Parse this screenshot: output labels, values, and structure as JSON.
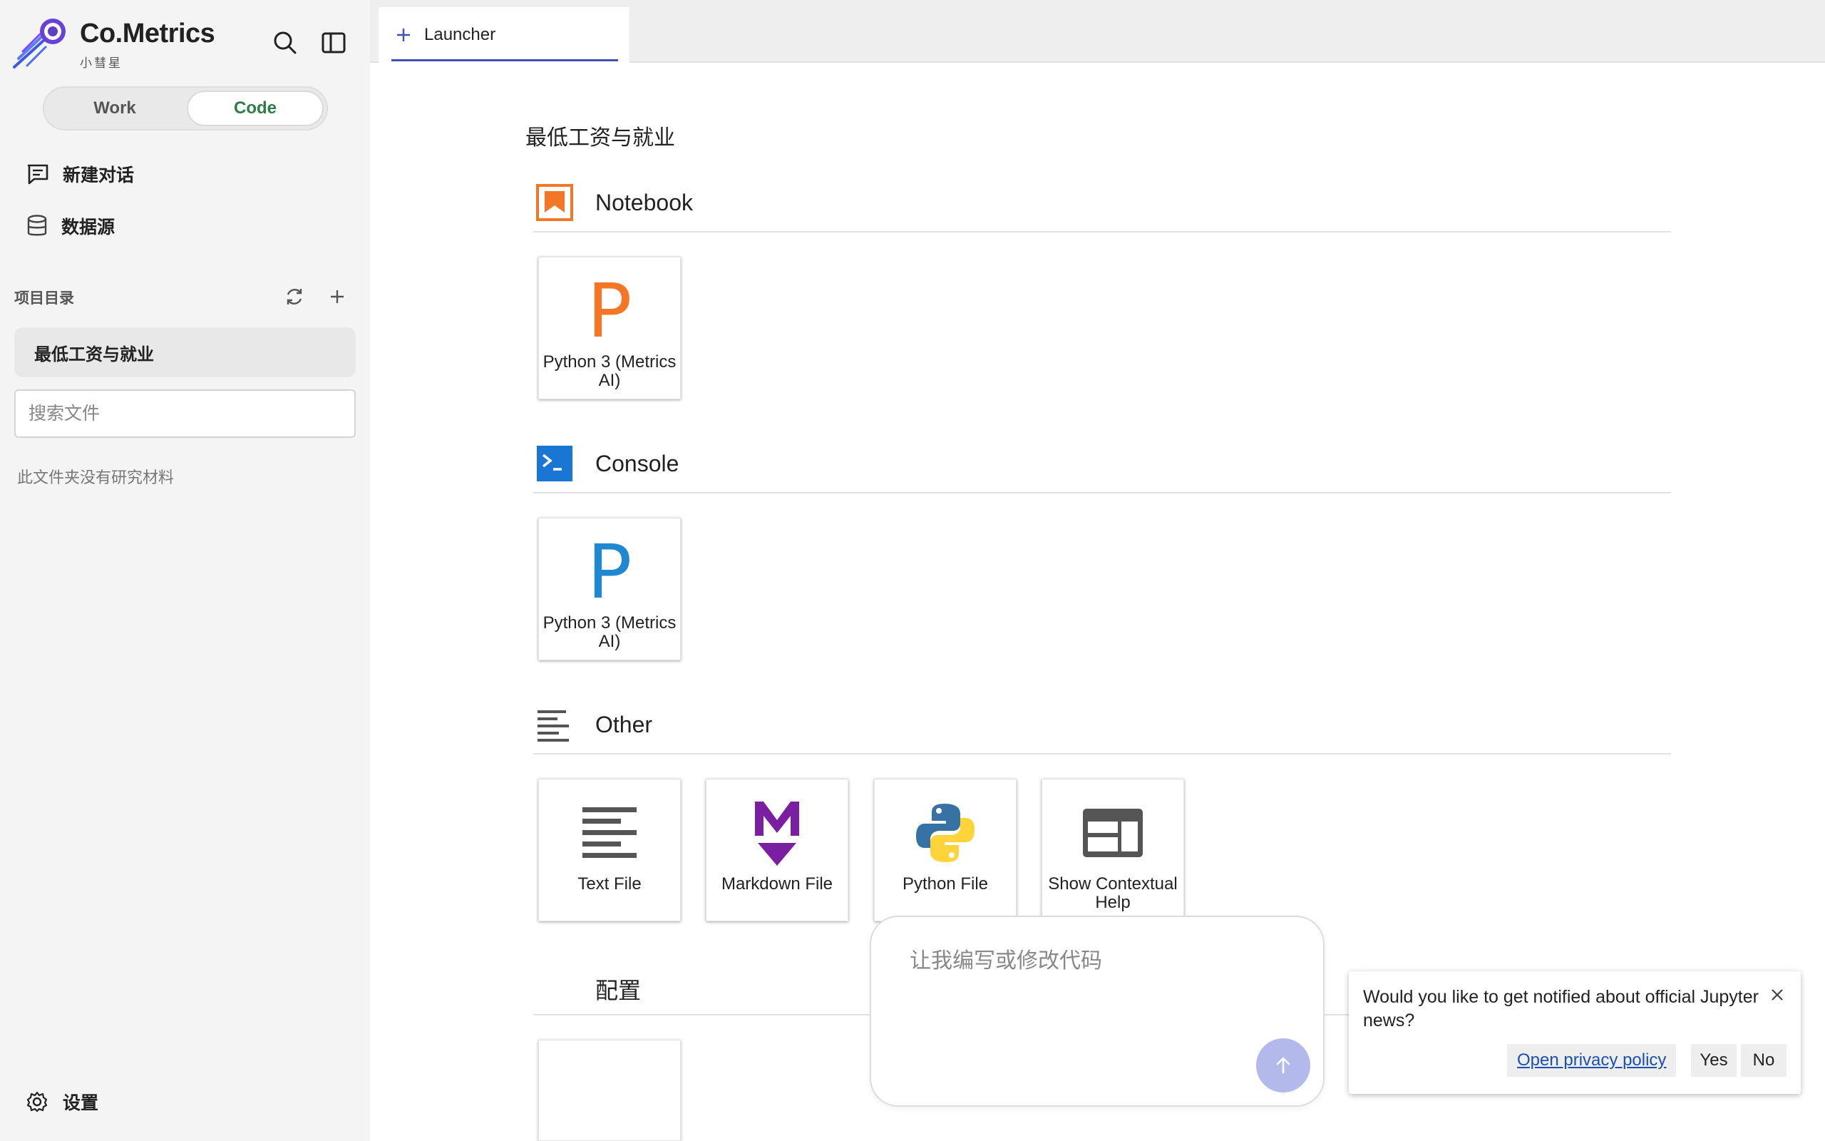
{
  "brand": {
    "name": "Co.Metrics",
    "subtitle": "小彗星",
    "logo_icon": "comet-logo"
  },
  "header_icons": [
    "search-icon",
    "panel-toggle-icon"
  ],
  "mode_toggle": {
    "options": [
      "Work",
      "Code"
    ],
    "selected": "Code",
    "selected_color": "#2f7d46"
  },
  "nav": {
    "new_chat": {
      "label": "新建对话",
      "icon": "chat-bubble-icon"
    },
    "data_source": {
      "label": "数据源",
      "icon": "database-icon"
    }
  },
  "project": {
    "header": "项目目录",
    "item": "最低工资与就业",
    "search_placeholder": "搜索文件",
    "empty_note": "此文件夹没有研究材料"
  },
  "settings": {
    "label": "设置",
    "icon": "gear-icon"
  },
  "tabs": [
    {
      "label": "Launcher",
      "active": true,
      "accent": "#3f51b5"
    }
  ],
  "launcher": {
    "title": "最低工资与就业",
    "sections": {
      "notebook": {
        "label": "Notebook",
        "cards": [
          {
            "letter": "P",
            "label": "Python 3 (Metrics AI)",
            "color": "#f37726"
          }
        ]
      },
      "console": {
        "label": "Console",
        "cards": [
          {
            "letter": "P",
            "label": "Python 3 (Metrics AI)",
            "color": "#1f88d0"
          }
        ]
      },
      "other": {
        "label": "Other",
        "cards": [
          {
            "label": "Text File",
            "icon": "text-file-icon"
          },
          {
            "label": "Markdown File",
            "icon": "markdown-icon",
            "color": "#7b1fa2"
          },
          {
            "label": "Python File",
            "icon": "python-logo-icon"
          },
          {
            "label": "Show Contextual Help",
            "icon": "contextual-help-icon"
          }
        ]
      },
      "config": {
        "label": "配置"
      }
    }
  },
  "chat": {
    "placeholder": "让我编写或修改代码"
  },
  "notification": {
    "message": "Would you like to get notified about official Jupyter news?",
    "privacy_link": "Open privacy policy",
    "yes": "Yes",
    "no": "No"
  }
}
